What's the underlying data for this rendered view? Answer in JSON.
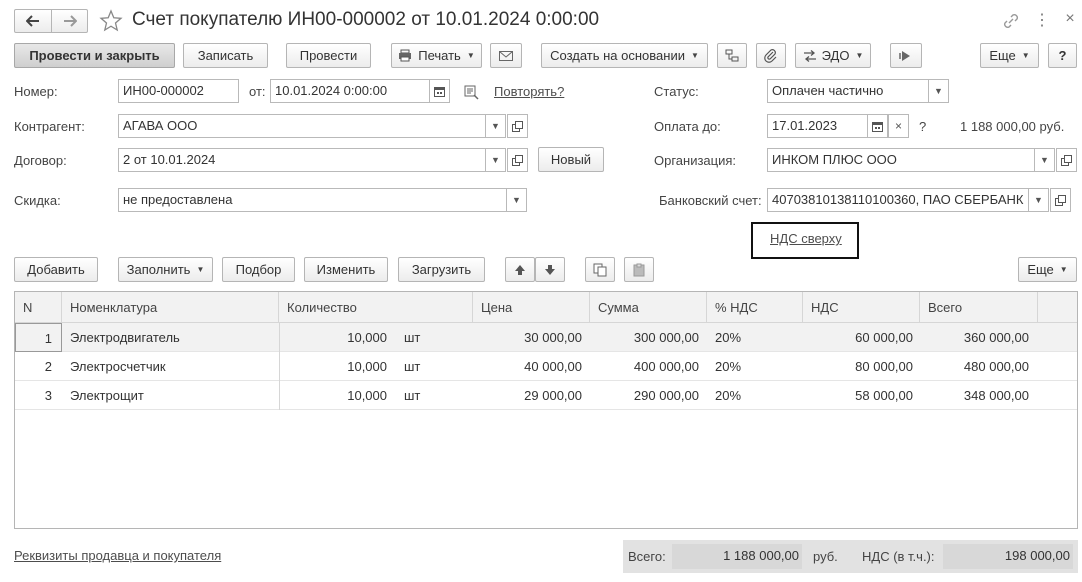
{
  "title": "Счет покупателю ИН00-000002 от 10.01.2024 0:00:00",
  "toolbar": {
    "post_close": "Провести и закрыть",
    "save": "Записать",
    "post": "Провести",
    "print": "Печать",
    "create_based": "Создать на основании",
    "edo": "ЭДО",
    "more": "Еще",
    "help": "?"
  },
  "form": {
    "number_label": "Номер:",
    "number_value": "ИН00-000002",
    "date_label": "от:",
    "date_value": "10.01.2024  0:00:00",
    "repeat_link": "Повторять?",
    "status_label": "Статус:",
    "status_value": "Оплачен частично",
    "counterparty_label": "Контрагент:",
    "counterparty_value": "АГАВА  ООО",
    "pay_until_label": "Оплата до:",
    "pay_until_value": "17.01.2023",
    "pay_question": "?",
    "pay_amount": "1 188 000,00 руб.",
    "contract_label": "Договор:",
    "contract_value": "2 от 10.01.2024",
    "new_button": "Новый",
    "organization_label": "Организация:",
    "organization_value": "ИНКОМ ПЛЮС ООО",
    "discount_label": "Скидка:",
    "discount_value": "не предоставлена",
    "bank_label": "Банковский счет:",
    "bank_value": "40703810138110100360, ПАО СБЕРБАНК",
    "vat_link": "НДС сверху"
  },
  "table_toolbar": {
    "add": "Добавить",
    "fill": "Заполнить",
    "pick": "Подбор",
    "edit": "Изменить",
    "load": "Загрузить",
    "more": "Еще"
  },
  "table": {
    "headers": [
      "N",
      "Номенклатура",
      "Количество",
      "Цена",
      "Сумма",
      "% НДС",
      "НДС",
      "Всего"
    ],
    "rows": [
      {
        "n": "1",
        "name": "Электродвигатель",
        "qty": "10,000",
        "unit": "шт",
        "price": "30 000,00",
        "sum": "300 000,00",
        "vat_rate": "20%",
        "vat": "60 000,00",
        "total": "360 000,00"
      },
      {
        "n": "2",
        "name": "Электросчетчик",
        "qty": "10,000",
        "unit": "шт",
        "price": "40 000,00",
        "sum": "400 000,00",
        "vat_rate": "20%",
        "vat": "80 000,00",
        "total": "480 000,00"
      },
      {
        "n": "3",
        "name": "Электрощит",
        "qty": "10,000",
        "unit": "шт",
        "price": "29 000,00",
        "sum": "290 000,00",
        "vat_rate": "20%",
        "vat": "58 000,00",
        "total": "348 000,00"
      }
    ]
  },
  "footer": {
    "requisites_link": "Реквизиты продавца и покупателя",
    "total_label": "Всего:",
    "total_value": "1 188 000,00",
    "currency": "руб.",
    "vat_label": "НДС (в т.ч.):",
    "vat_value": "198 000,00"
  }
}
